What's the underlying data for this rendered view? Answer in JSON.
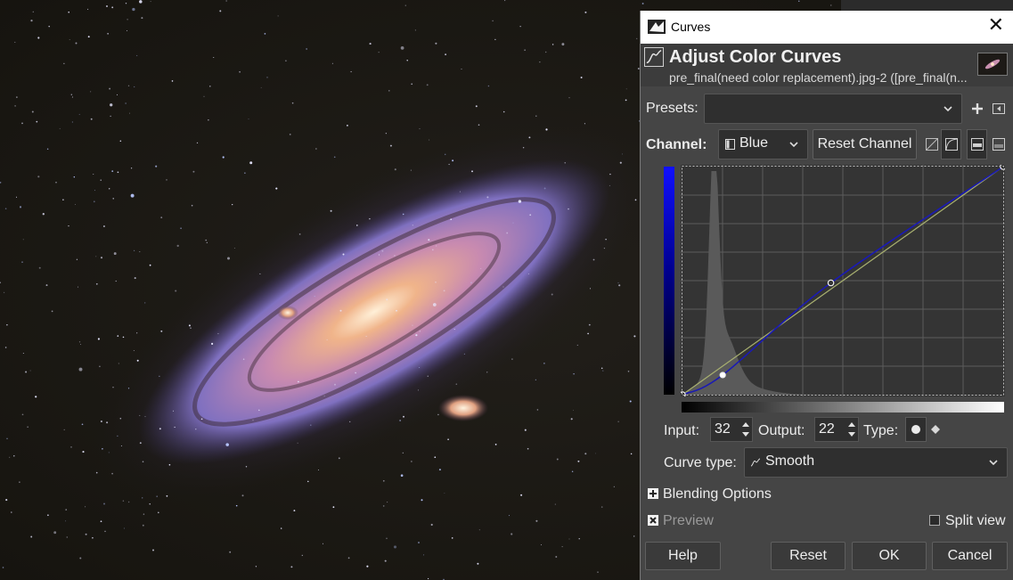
{
  "window": {
    "title": "Curves",
    "close_glyph": "✕"
  },
  "header": {
    "title": "Adjust Color Curves",
    "subtitle": "pre_final(need color replacement).jpg-2 ([pre_final(n..."
  },
  "presets": {
    "label": "Presets:",
    "value": ""
  },
  "channel": {
    "label": "Channel:",
    "value": "Blue",
    "reset_label": "Reset Channel"
  },
  "curve": {
    "channel_color": "#1a1ab4",
    "points": [
      [
        0,
        0
      ],
      [
        32,
        22
      ],
      [
        118,
        125
      ],
      [
        255,
        255
      ]
    ]
  },
  "input": {
    "label": "Input:",
    "value": "32"
  },
  "output": {
    "label": "Output:",
    "value": "22"
  },
  "type": {
    "label": "Type:"
  },
  "curve_type": {
    "label": "Curve type:",
    "value": "Smooth"
  },
  "blending": {
    "label": "Blending Options"
  },
  "preview": {
    "label": "Preview",
    "checked": true
  },
  "split_view": {
    "label": "Split view",
    "checked": false
  },
  "buttons": {
    "help": "Help",
    "reset": "Reset",
    "ok": "OK",
    "cancel": "Cancel"
  },
  "icons": {
    "title": "gimp-icon",
    "header": "curves-icon",
    "presets_add": "plus-icon",
    "presets_menu": "menu-icon",
    "linear_hist": "linear-histogram-icon",
    "log_hist": "log-histogram-icon"
  }
}
